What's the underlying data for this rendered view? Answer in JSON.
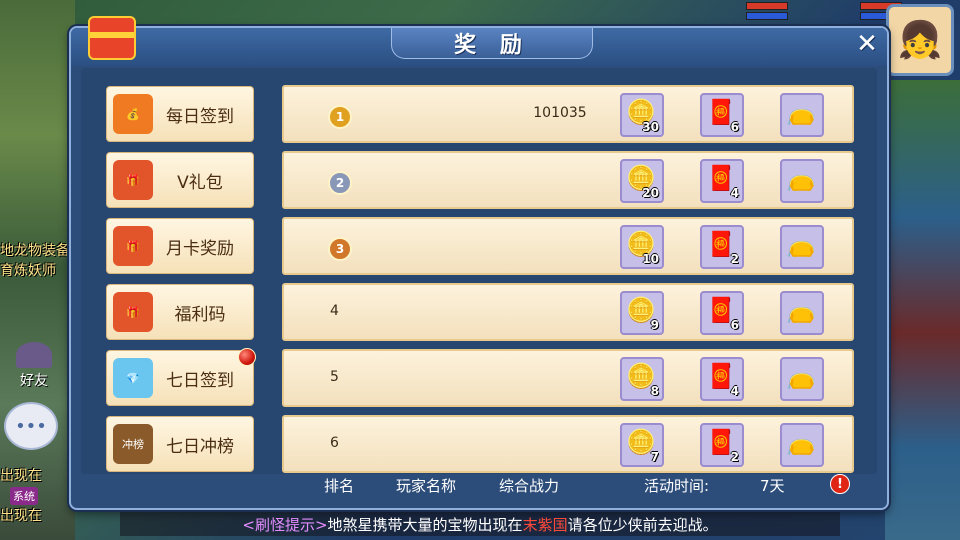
{
  "panel": {
    "title": "奖 励",
    "close_icon": "close-icon",
    "gift_icon": "gift-box-icon"
  },
  "background": {
    "left_texts": [
      "地龙物装备",
      "育炼妖师",
      "出现在",
      "出现在"
    ],
    "friend_label": "好友",
    "chat_icon": "chat-bubble-icon",
    "badge_label": "系统"
  },
  "menu": {
    "items": [
      {
        "label": "每日签到",
        "icon": "lucky-bag-icon",
        "icon_glyph": "💰",
        "icon_color": "#f07a22",
        "active": true,
        "red_dot": false
      },
      {
        "label": "V礼包",
        "icon": "treasure-bag-icon",
        "icon_glyph": "🎁",
        "icon_color": "#e2542a",
        "active": false,
        "red_dot": false
      },
      {
        "label": "月卡奖励",
        "icon": "treasure-bag-icon",
        "icon_glyph": "🎁",
        "icon_color": "#e2542a",
        "active": false,
        "red_dot": false
      },
      {
        "label": "福利码",
        "icon": "treasure-bag-icon",
        "icon_glyph": "🎁",
        "icon_color": "#e2542a",
        "active": false,
        "red_dot": false
      },
      {
        "label": "七日签到",
        "icon": "jade-bag-icon",
        "icon_glyph": "💎",
        "icon_color": "#6ac6ef",
        "active": false,
        "red_dot": true
      },
      {
        "label": "七日冲榜",
        "icon": "rank-chest-icon",
        "icon_glyph": "冲榜",
        "icon_color": "#8a5a2a",
        "active": false,
        "red_dot": false
      }
    ]
  },
  "rows": [
    {
      "rank": "1",
      "rank_style": "gold-medal",
      "power": "101035",
      "rewards": [
        {
          "icon": "gold-ingot-icon",
          "glyph": "🪙",
          "qty": "30"
        },
        {
          "icon": "red-bag-icon",
          "glyph": "🧧",
          "qty": "6"
        },
        {
          "icon": "purple-bag-icon",
          "glyph": "👝",
          "qty": ""
        }
      ]
    },
    {
      "rank": "2",
      "rank_style": "silver-medal",
      "power": "",
      "rewards": [
        {
          "icon": "gold-ingot-icon",
          "glyph": "🪙",
          "qty": "20"
        },
        {
          "icon": "red-bag-icon",
          "glyph": "🧧",
          "qty": "4"
        },
        {
          "icon": "purple-bag-icon",
          "glyph": "👝",
          "qty": ""
        }
      ]
    },
    {
      "rank": "3",
      "rank_style": "bronze-medal",
      "power": "",
      "rewards": [
        {
          "icon": "gold-ingot-icon",
          "glyph": "🪙",
          "qty": "10"
        },
        {
          "icon": "red-bag-icon",
          "glyph": "🧧",
          "qty": "2"
        },
        {
          "icon": "purple-bag-icon",
          "glyph": "👝",
          "qty": ""
        }
      ]
    },
    {
      "rank": "4",
      "rank_style": "text",
      "power": "",
      "rewards": [
        {
          "icon": "gold-ingot-icon",
          "glyph": "🪙",
          "qty": "9"
        },
        {
          "icon": "red-bag-icon",
          "glyph": "🧧",
          "qty": "6"
        },
        {
          "icon": "purple-bag-icon",
          "glyph": "👝",
          "qty": ""
        }
      ]
    },
    {
      "rank": "5",
      "rank_style": "text",
      "power": "",
      "rewards": [
        {
          "icon": "gold-ingot-icon",
          "glyph": "🪙",
          "qty": "8"
        },
        {
          "icon": "red-bag-icon",
          "glyph": "🧧",
          "qty": "4"
        },
        {
          "icon": "purple-bag-icon",
          "glyph": "👝",
          "qty": ""
        }
      ]
    },
    {
      "rank": "6",
      "rank_style": "text",
      "power": "",
      "rewards": [
        {
          "icon": "gold-ingot-icon",
          "glyph": "🪙",
          "qty": "7"
        },
        {
          "icon": "red-bag-icon",
          "glyph": "🧧",
          "qty": "2"
        },
        {
          "icon": "purple-bag-icon",
          "glyph": "👝",
          "qty": ""
        }
      ]
    }
  ],
  "footer": {
    "rank_label": "排名",
    "name_label": "玩家名称",
    "power_label": "综合战力",
    "time_label": "活动时间:",
    "time_value": "7天",
    "warn_icon": "alert-icon",
    "warn_glyph": "!"
  },
  "ticker": {
    "tag": "<刷怪提示>",
    "text_a": "地煞星携带大量的宝物出现在",
    "place": "末紫国",
    "text_b": "请各位少侠前去迎战。"
  },
  "colors": {
    "panel": "#2c4c7a",
    "row_bg": "#fdf2dc",
    "menu_text": "#4a2d12",
    "red_dot": "#d0150c"
  }
}
